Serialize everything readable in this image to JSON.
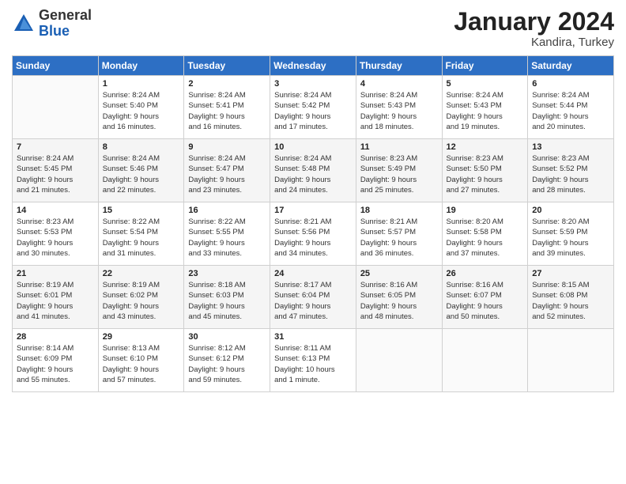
{
  "logo": {
    "general": "General",
    "blue": "Blue"
  },
  "title": "January 2024",
  "location": "Kandira, Turkey",
  "days_of_week": [
    "Sunday",
    "Monday",
    "Tuesday",
    "Wednesday",
    "Thursday",
    "Friday",
    "Saturday"
  ],
  "weeks": [
    [
      {
        "day": "",
        "info": ""
      },
      {
        "day": "1",
        "info": "Sunrise: 8:24 AM\nSunset: 5:40 PM\nDaylight: 9 hours\nand 16 minutes."
      },
      {
        "day": "2",
        "info": "Sunrise: 8:24 AM\nSunset: 5:41 PM\nDaylight: 9 hours\nand 16 minutes."
      },
      {
        "day": "3",
        "info": "Sunrise: 8:24 AM\nSunset: 5:42 PM\nDaylight: 9 hours\nand 17 minutes."
      },
      {
        "day": "4",
        "info": "Sunrise: 8:24 AM\nSunset: 5:43 PM\nDaylight: 9 hours\nand 18 minutes."
      },
      {
        "day": "5",
        "info": "Sunrise: 8:24 AM\nSunset: 5:43 PM\nDaylight: 9 hours\nand 19 minutes."
      },
      {
        "day": "6",
        "info": "Sunrise: 8:24 AM\nSunset: 5:44 PM\nDaylight: 9 hours\nand 20 minutes."
      }
    ],
    [
      {
        "day": "7",
        "info": "Sunrise: 8:24 AM\nSunset: 5:45 PM\nDaylight: 9 hours\nand 21 minutes."
      },
      {
        "day": "8",
        "info": "Sunrise: 8:24 AM\nSunset: 5:46 PM\nDaylight: 9 hours\nand 22 minutes."
      },
      {
        "day": "9",
        "info": "Sunrise: 8:24 AM\nSunset: 5:47 PM\nDaylight: 9 hours\nand 23 minutes."
      },
      {
        "day": "10",
        "info": "Sunrise: 8:24 AM\nSunset: 5:48 PM\nDaylight: 9 hours\nand 24 minutes."
      },
      {
        "day": "11",
        "info": "Sunrise: 8:23 AM\nSunset: 5:49 PM\nDaylight: 9 hours\nand 25 minutes."
      },
      {
        "day": "12",
        "info": "Sunrise: 8:23 AM\nSunset: 5:50 PM\nDaylight: 9 hours\nand 27 minutes."
      },
      {
        "day": "13",
        "info": "Sunrise: 8:23 AM\nSunset: 5:52 PM\nDaylight: 9 hours\nand 28 minutes."
      }
    ],
    [
      {
        "day": "14",
        "info": "Sunrise: 8:23 AM\nSunset: 5:53 PM\nDaylight: 9 hours\nand 30 minutes."
      },
      {
        "day": "15",
        "info": "Sunrise: 8:22 AM\nSunset: 5:54 PM\nDaylight: 9 hours\nand 31 minutes."
      },
      {
        "day": "16",
        "info": "Sunrise: 8:22 AM\nSunset: 5:55 PM\nDaylight: 9 hours\nand 33 minutes."
      },
      {
        "day": "17",
        "info": "Sunrise: 8:21 AM\nSunset: 5:56 PM\nDaylight: 9 hours\nand 34 minutes."
      },
      {
        "day": "18",
        "info": "Sunrise: 8:21 AM\nSunset: 5:57 PM\nDaylight: 9 hours\nand 36 minutes."
      },
      {
        "day": "19",
        "info": "Sunrise: 8:20 AM\nSunset: 5:58 PM\nDaylight: 9 hours\nand 37 minutes."
      },
      {
        "day": "20",
        "info": "Sunrise: 8:20 AM\nSunset: 5:59 PM\nDaylight: 9 hours\nand 39 minutes."
      }
    ],
    [
      {
        "day": "21",
        "info": "Sunrise: 8:19 AM\nSunset: 6:01 PM\nDaylight: 9 hours\nand 41 minutes."
      },
      {
        "day": "22",
        "info": "Sunrise: 8:19 AM\nSunset: 6:02 PM\nDaylight: 9 hours\nand 43 minutes."
      },
      {
        "day": "23",
        "info": "Sunrise: 8:18 AM\nSunset: 6:03 PM\nDaylight: 9 hours\nand 45 minutes."
      },
      {
        "day": "24",
        "info": "Sunrise: 8:17 AM\nSunset: 6:04 PM\nDaylight: 9 hours\nand 47 minutes."
      },
      {
        "day": "25",
        "info": "Sunrise: 8:16 AM\nSunset: 6:05 PM\nDaylight: 9 hours\nand 48 minutes."
      },
      {
        "day": "26",
        "info": "Sunrise: 8:16 AM\nSunset: 6:07 PM\nDaylight: 9 hours\nand 50 minutes."
      },
      {
        "day": "27",
        "info": "Sunrise: 8:15 AM\nSunset: 6:08 PM\nDaylight: 9 hours\nand 52 minutes."
      }
    ],
    [
      {
        "day": "28",
        "info": "Sunrise: 8:14 AM\nSunset: 6:09 PM\nDaylight: 9 hours\nand 55 minutes."
      },
      {
        "day": "29",
        "info": "Sunrise: 8:13 AM\nSunset: 6:10 PM\nDaylight: 9 hours\nand 57 minutes."
      },
      {
        "day": "30",
        "info": "Sunrise: 8:12 AM\nSunset: 6:12 PM\nDaylight: 9 hours\nand 59 minutes."
      },
      {
        "day": "31",
        "info": "Sunrise: 8:11 AM\nSunset: 6:13 PM\nDaylight: 10 hours\nand 1 minute."
      },
      {
        "day": "",
        "info": ""
      },
      {
        "day": "",
        "info": ""
      },
      {
        "day": "",
        "info": ""
      }
    ]
  ]
}
